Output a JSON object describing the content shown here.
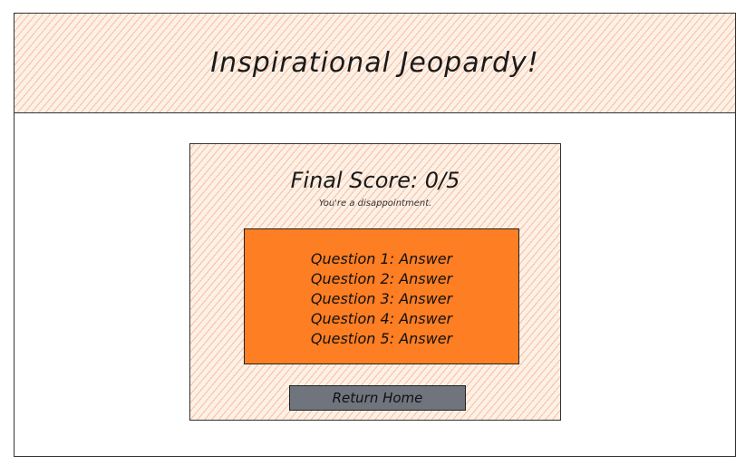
{
  "header": {
    "title": "Inspirational Jeopardy!"
  },
  "result": {
    "final_score": "Final Score: 0/5",
    "message": "You're a disappointment.",
    "answers": [
      {
        "question": "Question 1:",
        "answer": "Answer"
      },
      {
        "question": "Question 2:",
        "answer": "Answer"
      },
      {
        "question": "Question 3:",
        "answer": "Answer"
      },
      {
        "question": "Question 4:",
        "answer": "Answer"
      },
      {
        "question": "Question 5:",
        "answer": "Answer"
      }
    ],
    "return_label": "Return Home"
  },
  "colors": {
    "header_hatch": "#f0966a",
    "answers_box": "#fd7e23",
    "button": "#6f747d"
  }
}
